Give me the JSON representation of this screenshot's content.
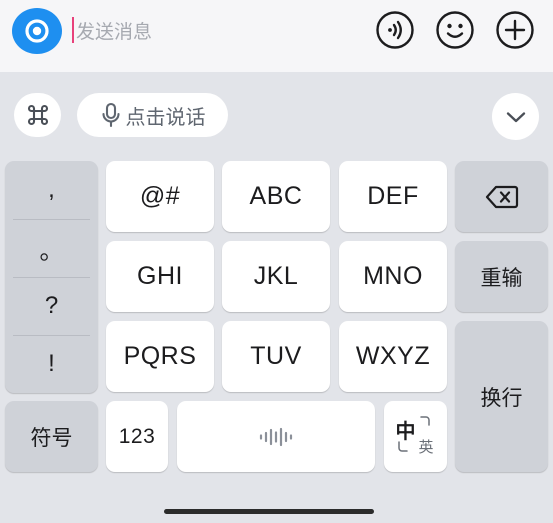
{
  "input_bar": {
    "placeholder": "发送消息",
    "icons": [
      "camera-icon",
      "voice-message-icon",
      "emoji-icon",
      "plus-icon"
    ],
    "accent_color": "#1e8ff0",
    "caret_color": "#e8417b"
  },
  "toolbar": {
    "voice_button_label": "点击说话",
    "icons": [
      "command-icon",
      "microphone-icon",
      "chevron-down-icon"
    ]
  },
  "keyboard": {
    "punctuation": [
      ",",
      "。",
      "?",
      "!"
    ],
    "nine_keys": [
      "@#",
      "ABC",
      "DEF",
      "GHI",
      "JKL",
      "MNO",
      "PQRS",
      "TUV",
      "WXYZ"
    ],
    "symbols_key": "符号",
    "numbers_key": "123",
    "reenter_key": "重输",
    "newline_key": "换行",
    "lang_key_main": "中",
    "lang_key_sub": "英",
    "space_icon": "waveform-icon",
    "delete_icon": "backspace-icon"
  }
}
